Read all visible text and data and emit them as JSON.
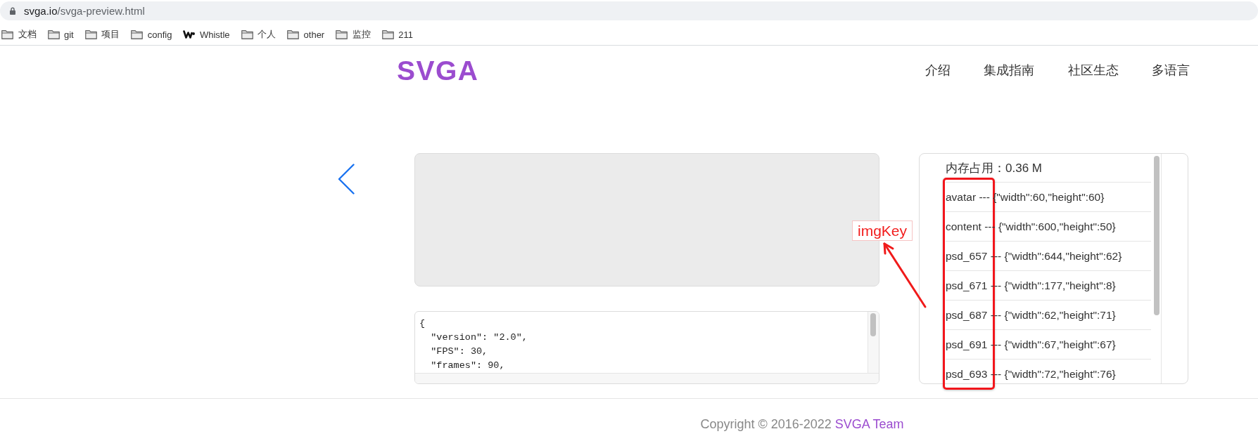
{
  "address_bar": {
    "host": "svga.io",
    "path": "/svga-preview.html"
  },
  "bookmarks": [
    {
      "kind": "folder",
      "label": "文档"
    },
    {
      "kind": "folder",
      "label": "git"
    },
    {
      "kind": "folder",
      "label": "项目"
    },
    {
      "kind": "folder",
      "label": "config"
    },
    {
      "kind": "site",
      "label": "Whistle"
    },
    {
      "kind": "folder",
      "label": "个人"
    },
    {
      "kind": "folder",
      "label": "other"
    },
    {
      "kind": "folder",
      "label": "监控"
    },
    {
      "kind": "folder",
      "label": "211"
    }
  ],
  "header": {
    "logo": "SVGA",
    "nav": [
      {
        "label": "介绍"
      },
      {
        "label": "集成指南"
      },
      {
        "label": "社区生态"
      },
      {
        "label": "多语言"
      }
    ]
  },
  "preview": {
    "json_lines": [
      "{",
      "  \"version\": \"2.0\",",
      "  \"FPS\": 30,",
      "  \"frames\": 90,"
    ]
  },
  "memory_panel": {
    "usage": "内存占用：0.36 M",
    "images": [
      "avatar --- {\"width\":60,\"height\":60}",
      "content --- {\"width\":600,\"height\":50}",
      "psd_657 --- {\"width\":644,\"height\":62}",
      "psd_671 --- {\"width\":177,\"height\":8}",
      "psd_687 --- {\"width\":62,\"height\":71}",
      "psd_691 --- {\"width\":67,\"height\":67}",
      "psd_693 --- {\"width\":72,\"height\":76}"
    ]
  },
  "annotation": {
    "label": "imgKey"
  },
  "footer": {
    "text": "Copyright © 2016-2022",
    "link": "SVGA Team"
  }
}
